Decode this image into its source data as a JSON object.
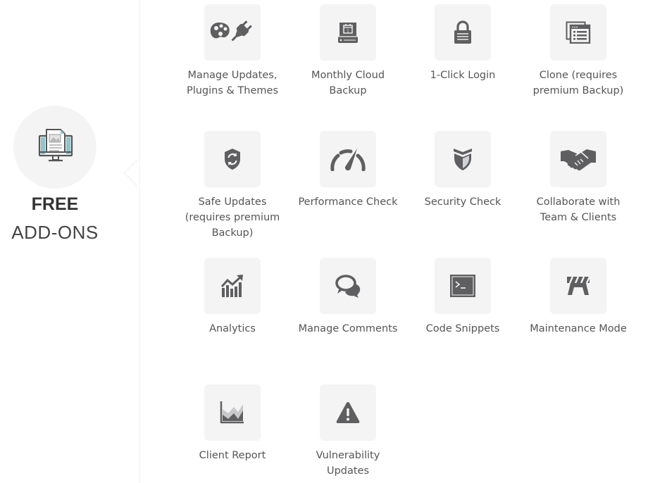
{
  "hero": {
    "icon": "monitor-document-icon",
    "title_bold": "FREE",
    "title_light": "ADD-ONS"
  },
  "colors": {
    "icon": "#5f5f61",
    "tile_bg": "#f4f4f4",
    "label": "#555555",
    "accent_teal": "#8fc4cc"
  },
  "addons": [
    {
      "label": "Manage Updates, Plugins & Themes",
      "icon": "palette-plug-icon"
    },
    {
      "label": "Monthly Cloud Backup",
      "icon": "calendar-drive-icon"
    },
    {
      "label": "1-Click Login",
      "icon": "lock-icon"
    },
    {
      "label": "Clone (requires premium Backup)",
      "icon": "windows-clone-icon"
    },
    {
      "label": "Safe Updates (requires premium Backup)",
      "icon": "shield-refresh-icon"
    },
    {
      "label": "Performance Check",
      "icon": "speedometer-icon"
    },
    {
      "label": "Security Check",
      "icon": "shield-icon"
    },
    {
      "label": "Collaborate with Team & Clients",
      "icon": "handshake-icon"
    },
    {
      "label": "Analytics",
      "icon": "analytics-chart-icon"
    },
    {
      "label": "Manage Comments",
      "icon": "comments-icon"
    },
    {
      "label": "Code Snippets",
      "icon": "terminal-icon"
    },
    {
      "label": "Maintenance Mode",
      "icon": "barrier-icon"
    },
    {
      "label": "Client Report",
      "icon": "area-chart-icon"
    },
    {
      "label": "Vulnerability Updates",
      "icon": "warning-icon"
    }
  ]
}
